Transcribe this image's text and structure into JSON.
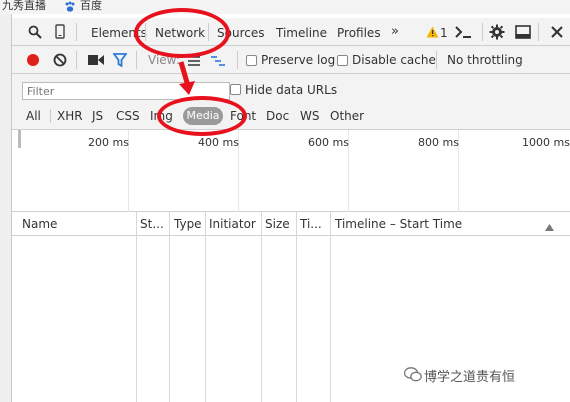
{
  "bookmarks": [
    {
      "label": "九秀直播"
    },
    {
      "label": "百度"
    }
  ],
  "devtools_tabs": [
    {
      "label": "Elements"
    },
    {
      "label": "Network"
    },
    {
      "label": "Sources"
    },
    {
      "label": "Timeline"
    },
    {
      "label": "Profiles"
    }
  ],
  "overflow_label": "»",
  "warnings_count": "1",
  "toolbar": {
    "view_label": "View:",
    "preserve_log": "Preserve log",
    "disable_cache": "Disable cache",
    "throttling": "No throttling"
  },
  "filter": {
    "placeholder": "Filter",
    "hide_data_urls": "Hide data URLs"
  },
  "types": [
    {
      "label": "All"
    },
    {
      "label": "XHR"
    },
    {
      "label": "JS"
    },
    {
      "label": "CSS"
    },
    {
      "label": "Img"
    },
    {
      "label": "Media"
    },
    {
      "label": "Font"
    },
    {
      "label": "Doc"
    },
    {
      "label": "WS"
    },
    {
      "label": "Other"
    }
  ],
  "timeline_ticks": [
    {
      "label": "200 ms"
    },
    {
      "label": "400 ms"
    },
    {
      "label": "600 ms"
    },
    {
      "label": "800 ms"
    },
    {
      "label": "1000 ms"
    }
  ],
  "columns": [
    {
      "label": "Name"
    },
    {
      "label": "St..."
    },
    {
      "label": "Type"
    },
    {
      "label": "Initiator"
    },
    {
      "label": "Size"
    },
    {
      "label": "Ti..."
    },
    {
      "label": "Timeline – Start Time"
    }
  ],
  "watermark": "博学之道贵有恒",
  "colors": {
    "annotation_red": "#e8121e",
    "record_red": "#e0201a",
    "filter_blue": "#2a7bd6",
    "media_pill": "#9a9a9a"
  }
}
